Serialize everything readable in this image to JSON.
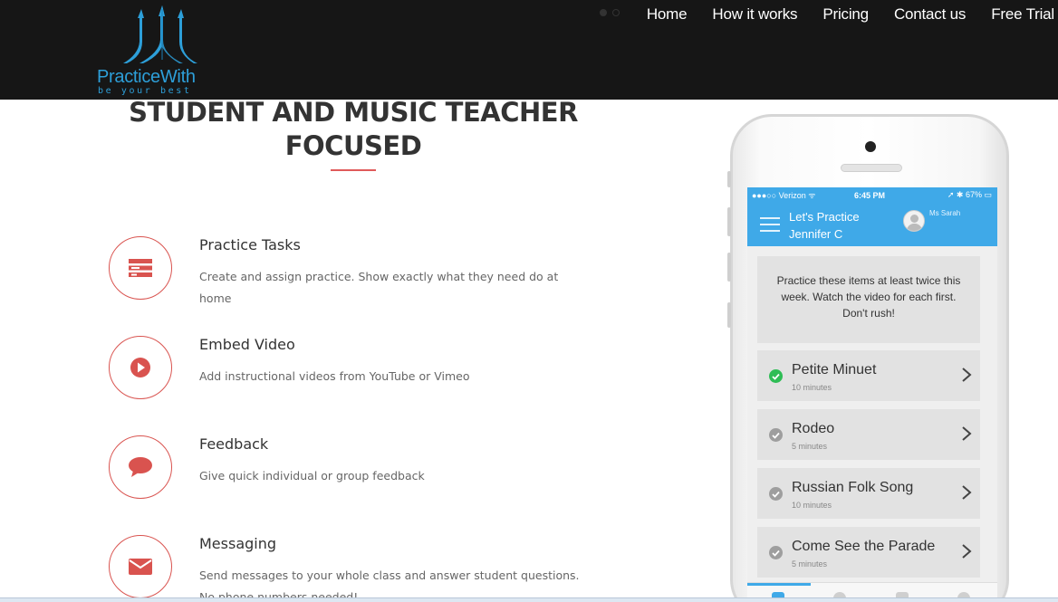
{
  "header": {
    "logo": {
      "name": "PracticeWith",
      "tagline": "be your best"
    },
    "nav": [
      "Home",
      "How it works",
      "Pricing",
      "Contact us",
      "Free Trial"
    ]
  },
  "section": {
    "title_line1": "STUDENT AND MUSIC TEACHER",
    "title_line2": "FOCUSED"
  },
  "features": [
    {
      "icon": "tasks-icon",
      "title": "Practice Tasks",
      "description": "Create and assign practice. Show exactly what they need do at home"
    },
    {
      "icon": "play-icon",
      "title": "Embed Video",
      "description": "Add instructional videos from YouTube or Vimeo"
    },
    {
      "icon": "comment-icon",
      "title": "Feedback",
      "description": "Give quick individual or group feedback"
    },
    {
      "icon": "envelope-icon",
      "title": "Messaging",
      "description": "Send messages to your whole class and answer student questions. No phone numbers needed!"
    }
  ],
  "phone": {
    "status": {
      "carrier": "●●●○○ Verizon ᯤ",
      "time": "6:45 PM",
      "battery": "➚ ✱ 67% ▭"
    },
    "app": {
      "title_line1": "Let's Practice",
      "title_line2": "Jennifer C",
      "teacher": "Ms Sarah"
    },
    "note": "Practice these items at least twice this week. Watch the video for each first. Don't rush!",
    "tasks": [
      {
        "name": "Petite Minuet",
        "duration": "10 minutes",
        "done": true
      },
      {
        "name": "Rodeo",
        "duration": "5 minutes",
        "done": false
      },
      {
        "name": "Russian Folk Song",
        "duration": "10 minutes",
        "done": false
      },
      {
        "name": "Come See the Parade",
        "duration": "5 minutes",
        "done": false
      }
    ]
  },
  "colors": {
    "header_bg": "#161616",
    "brand_blue": "#2d9fd9",
    "accent_red": "#d9534f",
    "app_blue": "#3fa9e8",
    "done_green": "#2ebd55"
  }
}
